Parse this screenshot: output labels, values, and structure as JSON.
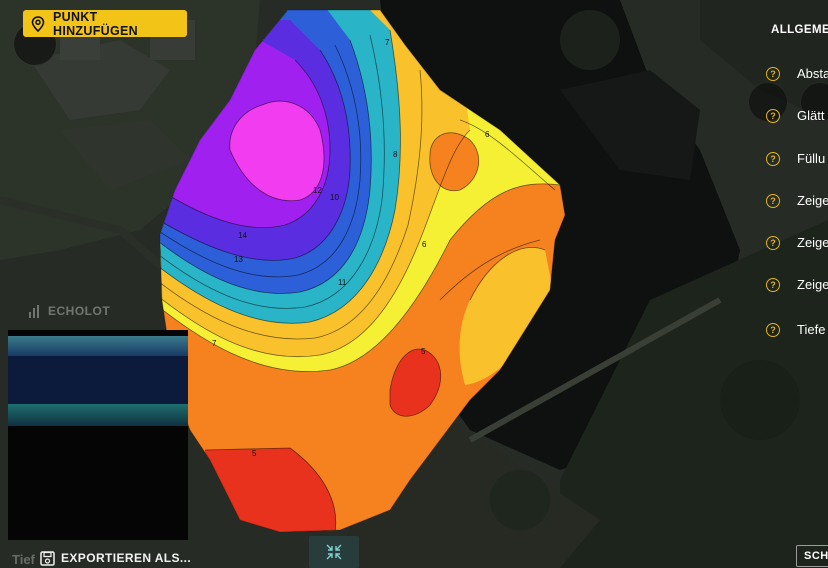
{
  "toolbar": {
    "add_point_label": "PUNKT HINZUFÜGEN",
    "add_point_icon": "map-pin-icon"
  },
  "sonar": {
    "tab_label": "ECHOLOT",
    "tab_icon": "signal-bars-icon"
  },
  "footer": {
    "export_label": "EXPORTIEREN ALS...",
    "export_icon": "save-icon",
    "depth_label": "Tief",
    "center_icon": "collapse-arrows-icon"
  },
  "settings": {
    "title": "ALLGEME",
    "rows": [
      {
        "label": "Absta"
      },
      {
        "label": "Glätt"
      },
      {
        "label": "Füllu"
      },
      {
        "label": "Zeige"
      },
      {
        "label": "Zeige"
      },
      {
        "label": "Zeige"
      },
      {
        "label": "Tiefe"
      }
    ],
    "help_glyph": "?",
    "bottom_button": "SCH"
  },
  "map": {
    "contour_labels": [
      "7",
      "8",
      "10",
      "11",
      "12",
      "14",
      "13",
      "7",
      "6",
      "5",
      "5",
      "6"
    ],
    "colors": {
      "shallow": "#e8321e",
      "mid": "#f5821e",
      "light": "#f9c22c",
      "yellow": "#f6f035",
      "teal": "#29b4c8",
      "blue": "#2d5fd9",
      "violet": "#5b2de0",
      "purple": "#a020f0",
      "magenta": "#f23cf0"
    }
  }
}
